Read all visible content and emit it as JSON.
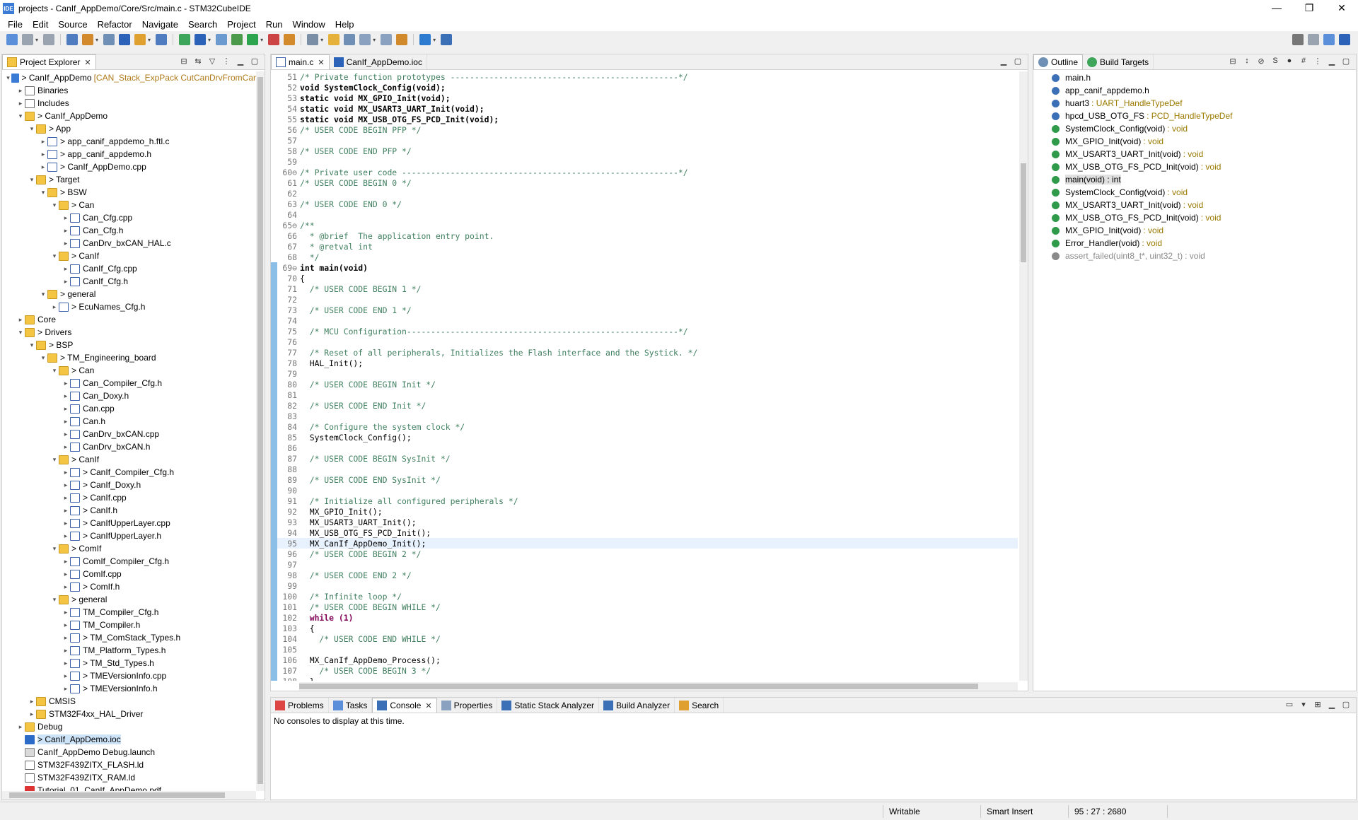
{
  "window": {
    "title": "projects - CanIf_AppDemo/Core/Src/main.c - STM32CubeIDE",
    "app_icon": "IDE",
    "minimize": "—",
    "maximize": "❐",
    "close": "✕"
  },
  "menu": [
    "File",
    "Edit",
    "Source",
    "Refactor",
    "Navigate",
    "Search",
    "Project",
    "Run",
    "Window",
    "Help"
  ],
  "explorer": {
    "tab_label": "Project Explorer",
    "items": [
      {
        "depth": 0,
        "arrow": "v",
        "icon": "project",
        "label": "> CanIf_AppDemo",
        "extra": "[CAN_Stack_ExpPack CutCanDrvFromCar"
      },
      {
        "depth": 1,
        "arrow": ">",
        "icon": "file",
        "label": "Binaries"
      },
      {
        "depth": 1,
        "arrow": ">",
        "icon": "file",
        "label": "Includes"
      },
      {
        "depth": 1,
        "arrow": "v",
        "icon": "folder",
        "label": "> CanIf_AppDemo"
      },
      {
        "depth": 2,
        "arrow": "v",
        "icon": "folder",
        "label": "> App"
      },
      {
        "depth": 3,
        "arrow": ">",
        "icon": "cfile",
        "label": "> app_canif_appdemo_h.ftl.c"
      },
      {
        "depth": 3,
        "arrow": ">",
        "icon": "cfile",
        "label": "> app_canif_appdemo.h"
      },
      {
        "depth": 3,
        "arrow": ">",
        "icon": "cfile",
        "label": "> CanIf_AppDemo.cpp"
      },
      {
        "depth": 2,
        "arrow": "v",
        "icon": "folder",
        "label": "> Target"
      },
      {
        "depth": 3,
        "arrow": "v",
        "icon": "folder",
        "label": "> BSW"
      },
      {
        "depth": 4,
        "arrow": "v",
        "icon": "folder",
        "label": "> Can"
      },
      {
        "depth": 5,
        "arrow": ">",
        "icon": "cfile",
        "label": "Can_Cfg.cpp"
      },
      {
        "depth": 5,
        "arrow": ">",
        "icon": "cfile",
        "label": "Can_Cfg.h"
      },
      {
        "depth": 5,
        "arrow": ">",
        "icon": "cfile",
        "label": "CanDrv_bxCAN_HAL.c"
      },
      {
        "depth": 4,
        "arrow": "v",
        "icon": "folder",
        "label": "> CanIf"
      },
      {
        "depth": 5,
        "arrow": ">",
        "icon": "cfile",
        "label": "CanIf_Cfg.cpp"
      },
      {
        "depth": 5,
        "arrow": ">",
        "icon": "cfile",
        "label": "CanIf_Cfg.h"
      },
      {
        "depth": 3,
        "arrow": "v",
        "icon": "folder",
        "label": "> general"
      },
      {
        "depth": 4,
        "arrow": ">",
        "icon": "cfile",
        "label": "> EcuNames_Cfg.h"
      },
      {
        "depth": 1,
        "arrow": ">",
        "icon": "folder",
        "label": "Core"
      },
      {
        "depth": 1,
        "arrow": "v",
        "icon": "folder",
        "label": "> Drivers"
      },
      {
        "depth": 2,
        "arrow": "v",
        "icon": "folder",
        "label": "> BSP"
      },
      {
        "depth": 3,
        "arrow": "v",
        "icon": "folder",
        "label": "> TM_Engineering_board"
      },
      {
        "depth": 4,
        "arrow": "v",
        "icon": "folder",
        "label": "> Can"
      },
      {
        "depth": 5,
        "arrow": ">",
        "icon": "cfile",
        "label": "Can_Compiler_Cfg.h"
      },
      {
        "depth": 5,
        "arrow": ">",
        "icon": "cfile",
        "label": "Can_Doxy.h"
      },
      {
        "depth": 5,
        "arrow": ">",
        "icon": "cfile",
        "label": "Can.cpp"
      },
      {
        "depth": 5,
        "arrow": ">",
        "icon": "cfile",
        "label": "Can.h"
      },
      {
        "depth": 5,
        "arrow": ">",
        "icon": "cfile",
        "label": "CanDrv_bxCAN.cpp"
      },
      {
        "depth": 5,
        "arrow": ">",
        "icon": "cfile",
        "label": "CanDrv_bxCAN.h"
      },
      {
        "depth": 4,
        "arrow": "v",
        "icon": "folder",
        "label": "> CanIf"
      },
      {
        "depth": 5,
        "arrow": ">",
        "icon": "cfile",
        "label": "> CanIf_Compiler_Cfg.h"
      },
      {
        "depth": 5,
        "arrow": ">",
        "icon": "cfile",
        "label": "> CanIf_Doxy.h"
      },
      {
        "depth": 5,
        "arrow": ">",
        "icon": "cfile",
        "label": "> CanIf.cpp"
      },
      {
        "depth": 5,
        "arrow": ">",
        "icon": "cfile",
        "label": "> CanIf.h"
      },
      {
        "depth": 5,
        "arrow": ">",
        "icon": "cfile",
        "label": "> CanIfUpperLayer.cpp"
      },
      {
        "depth": 5,
        "arrow": ">",
        "icon": "cfile",
        "label": "> CanIfUpperLayer.h"
      },
      {
        "depth": 4,
        "arrow": "v",
        "icon": "folder",
        "label": "> ComIf"
      },
      {
        "depth": 5,
        "arrow": ">",
        "icon": "cfile",
        "label": "ComIf_Compiler_Cfg.h"
      },
      {
        "depth": 5,
        "arrow": ">",
        "icon": "cfile",
        "label": "ComIf.cpp"
      },
      {
        "depth": 5,
        "arrow": ">",
        "icon": "cfile",
        "label": "> ComIf.h"
      },
      {
        "depth": 4,
        "arrow": "v",
        "icon": "folder",
        "label": "> general"
      },
      {
        "depth": 5,
        "arrow": ">",
        "icon": "cfile",
        "label": "TM_Compiler_Cfg.h"
      },
      {
        "depth": 5,
        "arrow": ">",
        "icon": "cfile",
        "label": "TM_Compiler.h"
      },
      {
        "depth": 5,
        "arrow": ">",
        "icon": "cfile",
        "label": "> TM_ComStack_Types.h"
      },
      {
        "depth": 5,
        "arrow": ">",
        "icon": "cfile",
        "label": "TM_Platform_Types.h"
      },
      {
        "depth": 5,
        "arrow": ">",
        "icon": "cfile",
        "label": "> TM_Std_Types.h"
      },
      {
        "depth": 5,
        "arrow": ">",
        "icon": "cfile",
        "label": "> TMEVersionInfo.cpp"
      },
      {
        "depth": 5,
        "arrow": ">",
        "icon": "cfile",
        "label": "> TMEVersionInfo.h"
      },
      {
        "depth": 2,
        "arrow": ">",
        "icon": "folder",
        "label": "CMSIS"
      },
      {
        "depth": 2,
        "arrow": ">",
        "icon": "folder",
        "label": "STM32F4xx_HAL_Driver"
      },
      {
        "depth": 1,
        "arrow": ">",
        "icon": "folder",
        "label": "Debug"
      },
      {
        "depth": 1,
        "arrow": "",
        "icon": "mx",
        "label": "> CanIf_AppDemo.ioc",
        "selected": true
      },
      {
        "depth": 1,
        "arrow": "",
        "icon": "launch",
        "label": "CanIf_AppDemo Debug.launch"
      },
      {
        "depth": 1,
        "arrow": "",
        "icon": "file",
        "label": "STM32F439ZITX_FLASH.ld"
      },
      {
        "depth": 1,
        "arrow": "",
        "icon": "file",
        "label": "STM32F439ZITX_RAM.ld"
      },
      {
        "depth": 1,
        "arrow": "",
        "icon": "pdf",
        "label": "Tutorial_01_CanIf_AppDemo.pdf"
      }
    ]
  },
  "editor": {
    "tabs": [
      {
        "label": "main.c",
        "icon": "c-file-icon",
        "active": true
      },
      {
        "label": "CanIf_AppDemo.ioc",
        "icon": "mx-icon",
        "active": false
      }
    ],
    "lines": [
      {
        "n": "51",
        "t": "/* Private function prototypes -----------------------------------------------*/",
        "c": "comment"
      },
      {
        "n": "52",
        "t": "void SystemClock_Config(void);",
        "c": "decl"
      },
      {
        "n": "53",
        "t": "static void MX_GPIO_Init(void);",
        "c": "decl"
      },
      {
        "n": "54",
        "t": "static void MX_USART3_UART_Init(void);",
        "c": "decl"
      },
      {
        "n": "55",
        "t": "static void MX_USB_OTG_FS_PCD_Init(void);",
        "c": "decl"
      },
      {
        "n": "56",
        "t": "/* USER CODE BEGIN PFP */",
        "c": "comment"
      },
      {
        "n": "57",
        "t": "",
        "c": ""
      },
      {
        "n": "58",
        "t": "/* USER CODE END PFP */",
        "c": "comment"
      },
      {
        "n": "59",
        "t": "",
        "c": ""
      },
      {
        "n": "60⊖",
        "t": "/* Private user code ---------------------------------------------------------*/",
        "c": "comment"
      },
      {
        "n": "61",
        "t": "/* USER CODE BEGIN 0 */",
        "c": "comment"
      },
      {
        "n": "62",
        "t": "",
        "c": ""
      },
      {
        "n": "63",
        "t": "/* USER CODE END 0 */",
        "c": "comment"
      },
      {
        "n": "64",
        "t": "",
        "c": ""
      },
      {
        "n": "65⊖",
        "t": "/**",
        "c": "comment"
      },
      {
        "n": "66",
        "t": "  * @brief  The application entry point.",
        "c": "comment"
      },
      {
        "n": "67",
        "t": "  * @retval int",
        "c": "comment"
      },
      {
        "n": "68",
        "t": "  */",
        "c": "comment"
      },
      {
        "n": "69⊖",
        "t": "int main(void)",
        "c": "decl",
        "mark": true
      },
      {
        "n": "70",
        "t": "{",
        "c": "",
        "mark": true
      },
      {
        "n": "71",
        "t": "  /* USER CODE BEGIN 1 */",
        "c": "comment",
        "mark": true
      },
      {
        "n": "72",
        "t": "",
        "c": "",
        "mark": true
      },
      {
        "n": "73",
        "t": "  /* USER CODE END 1 */",
        "c": "comment",
        "mark": true
      },
      {
        "n": "74",
        "t": "",
        "c": "",
        "mark": true
      },
      {
        "n": "75",
        "t": "  /* MCU Configuration--------------------------------------------------------*/",
        "c": "comment",
        "mark": true
      },
      {
        "n": "76",
        "t": "",
        "c": "",
        "mark": true
      },
      {
        "n": "77",
        "t": "  /* Reset of all peripherals, Initializes the Flash interface and the Systick. */",
        "c": "comment",
        "mark": true
      },
      {
        "n": "78",
        "t": "  HAL_Init();",
        "c": "",
        "mark": true
      },
      {
        "n": "79",
        "t": "",
        "c": "",
        "mark": true
      },
      {
        "n": "80",
        "t": "  /* USER CODE BEGIN Init */",
        "c": "comment",
        "mark": true
      },
      {
        "n": "81",
        "t": "",
        "c": "",
        "mark": true
      },
      {
        "n": "82",
        "t": "  /* USER CODE END Init */",
        "c": "comment",
        "mark": true
      },
      {
        "n": "83",
        "t": "",
        "c": "",
        "mark": true
      },
      {
        "n": "84",
        "t": "  /* Configure the system clock */",
        "c": "comment",
        "mark": true
      },
      {
        "n": "85",
        "t": "  SystemClock_Config();",
        "c": "",
        "mark": true
      },
      {
        "n": "86",
        "t": "",
        "c": "",
        "mark": true
      },
      {
        "n": "87",
        "t": "  /* USER CODE BEGIN SysInit */",
        "c": "comment",
        "mark": true
      },
      {
        "n": "88",
        "t": "",
        "c": "",
        "mark": true
      },
      {
        "n": "89",
        "t": "  /* USER CODE END SysInit */",
        "c": "comment",
        "mark": true
      },
      {
        "n": "90",
        "t": "",
        "c": "",
        "mark": true
      },
      {
        "n": "91",
        "t": "  /* Initialize all configured peripherals */",
        "c": "comment",
        "mark": true
      },
      {
        "n": "92",
        "t": "  MX_GPIO_Init();",
        "c": "",
        "mark": true
      },
      {
        "n": "93",
        "t": "  MX_USART3_UART_Init();",
        "c": "",
        "mark": true
      },
      {
        "n": "94",
        "t": "  MX_USB_OTG_FS_PCD_Init();",
        "c": "",
        "mark": true
      },
      {
        "n": "95",
        "t": "  MX_CanIf_AppDemo_Init();",
        "c": "",
        "mark": true,
        "current": true
      },
      {
        "n": "96",
        "t": "  /* USER CODE BEGIN 2 */",
        "c": "comment",
        "mark": true
      },
      {
        "n": "97",
        "t": "",
        "c": "",
        "mark": true
      },
      {
        "n": "98",
        "t": "  /* USER CODE END 2 */",
        "c": "comment",
        "mark": true
      },
      {
        "n": "99",
        "t": "",
        "c": "",
        "mark": true
      },
      {
        "n": "100",
        "t": "  /* Infinite loop */",
        "c": "comment",
        "mark": true
      },
      {
        "n": "101",
        "t": "  /* USER CODE BEGIN WHILE */",
        "c": "comment",
        "mark": true
      },
      {
        "n": "102",
        "t": "  while (1)",
        "c": "kw",
        "mark": true
      },
      {
        "n": "103",
        "t": "  {",
        "c": "",
        "mark": true
      },
      {
        "n": "104",
        "t": "    /* USER CODE END WHILE */",
        "c": "comment",
        "mark": true
      },
      {
        "n": "105",
        "t": "",
        "c": "",
        "mark": true
      },
      {
        "n": "106",
        "t": "  MX_CanIf_AppDemo_Process();",
        "c": "",
        "mark": true
      },
      {
        "n": "107",
        "t": "    /* USER CODE BEGIN 3 */",
        "c": "comment",
        "mark": true
      },
      {
        "n": "108",
        "t": "  }",
        "c": "",
        "mark": true
      }
    ]
  },
  "outline": {
    "tabs": [
      {
        "label": "Outline",
        "active": true
      },
      {
        "label": "Build Targets",
        "active": false
      }
    ],
    "items": [
      {
        "name": "main.h",
        "type": "",
        "icon": "#3b6fb6"
      },
      {
        "name": "app_canif_appdemo.h",
        "type": "",
        "icon": "#3b6fb6"
      },
      {
        "name": "huart3",
        "type": ": UART_HandleTypeDef",
        "icon": "#3b6fb6"
      },
      {
        "name": "hpcd_USB_OTG_FS",
        "type": ": PCD_HandleTypeDef",
        "icon": "#3b6fb6"
      },
      {
        "name": "SystemClock_Config(void)",
        "type": ": void",
        "icon": "#2e9a4a"
      },
      {
        "name": "MX_GPIO_Init(void)",
        "type": ": void",
        "icon": "#2e9a4a"
      },
      {
        "name": "MX_USART3_UART_Init(void)",
        "type": ": void",
        "icon": "#2e9a4a"
      },
      {
        "name": "MX_USB_OTG_FS_PCD_Init(void)",
        "type": ": void",
        "icon": "#2e9a4a"
      },
      {
        "name": "main(void) : int",
        "type": "",
        "icon": "#2e9a4a",
        "selected": true
      },
      {
        "name": "SystemClock_Config(void)",
        "type": ": void",
        "icon": "#2e9a4a"
      },
      {
        "name": "MX_USART3_UART_Init(void)",
        "type": ": void",
        "icon": "#2e9a4a"
      },
      {
        "name": "MX_USB_OTG_FS_PCD_Init(void)",
        "type": ": void",
        "icon": "#2e9a4a"
      },
      {
        "name": "MX_GPIO_Init(void)",
        "type": ": void",
        "icon": "#2e9a4a"
      },
      {
        "name": "Error_Handler(void)",
        "type": ": void",
        "icon": "#2e9a4a"
      },
      {
        "name": "assert_failed(uint8_t*, uint32_t)",
        "type": ": void",
        "icon": "#8a8a8a",
        "muted": true
      }
    ]
  },
  "console": {
    "tabs": [
      {
        "label": "Problems",
        "active": false
      },
      {
        "label": "Tasks",
        "active": false
      },
      {
        "label": "Console",
        "active": true
      },
      {
        "label": "Properties",
        "active": false
      },
      {
        "label": "Static Stack Analyzer",
        "active": false
      },
      {
        "label": "Build Analyzer",
        "active": false
      },
      {
        "label": "Search",
        "active": false
      }
    ],
    "message": "No consoles to display at this time."
  },
  "status": {
    "writable": "Writable",
    "insert": "Smart Insert",
    "position": "95 : 27 : 2680"
  }
}
